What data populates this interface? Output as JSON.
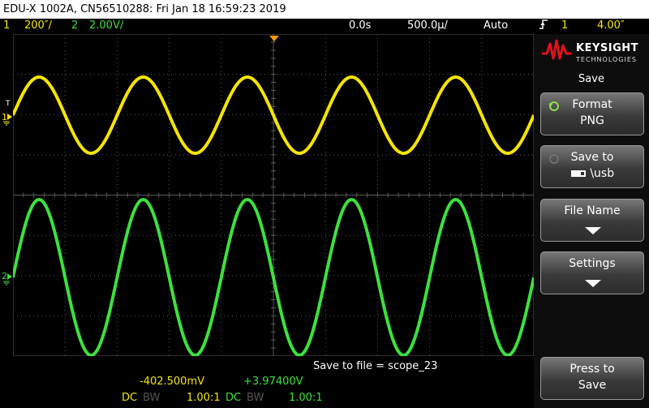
{
  "title": "EDU-X 1002A, CN56510288: Fri Jan 18 16:59:23 2019",
  "status": {
    "ch1_num": "1",
    "ch1_scale": "200″/",
    "ch2_num": "2",
    "ch2_scale": "2.00V/",
    "time_offset": "0.0s",
    "time_scale": "500.0µ/",
    "trigger_mode": "Auto",
    "trigger_channel": "1",
    "trigger_level": "4.00″"
  },
  "grid": {
    "ch1_marker": "1",
    "ch2_marker": "2",
    "trigger_marker": "T"
  },
  "panel": {
    "brand": "KEYSIGHT",
    "brand_sub": "TECHNOLOGIES",
    "title": "Save",
    "softkeys": [
      {
        "line1": "Format",
        "line2": "PNG"
      },
      {
        "line1": "Save to",
        "line2": "\\usb"
      },
      {
        "line1": "File Name",
        "line2": ""
      },
      {
        "line1": "Settings",
        "line2": ""
      },
      {
        "line1": "Press to",
        "line2": "Save"
      }
    ]
  },
  "message": "Save to file =  scope_23",
  "measurements": {
    "ch1_value": "-402.500mV",
    "ch2_value": "+3.97400V",
    "ch1_coupling": "DC",
    "ch1_bw": "BW",
    "ch1_probe": "1.00:1",
    "ch2_coupling": "DC",
    "ch2_bw": "BW",
    "ch2_probe": "1.00:1"
  },
  "colors": {
    "ch1": "#f5e400",
    "ch2": "#3ee03e",
    "grid": "#5a5a5a",
    "trigger": "#ff9a00"
  },
  "waveforms": {
    "ch1_periods": 5,
    "ch2_periods": 5
  }
}
